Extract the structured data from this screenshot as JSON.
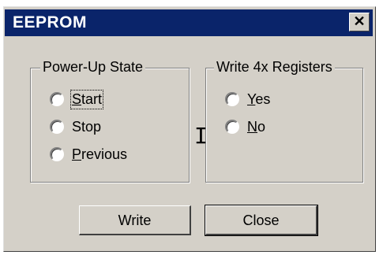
{
  "window": {
    "title": "EEPROM",
    "close_glyph": "✕"
  },
  "power_up": {
    "legend": "Power-Up State",
    "options": [
      {
        "label": "Start"
      },
      {
        "label": "Stop"
      },
      {
        "label": "Previous"
      }
    ]
  },
  "write4x": {
    "legend": "Write 4x Registers",
    "options": [
      {
        "label": "Yes"
      },
      {
        "label": "No"
      }
    ]
  },
  "buttons": {
    "write": "Write",
    "close": "Close"
  },
  "icons": {
    "text_cursor": "text-cursor-icon"
  }
}
